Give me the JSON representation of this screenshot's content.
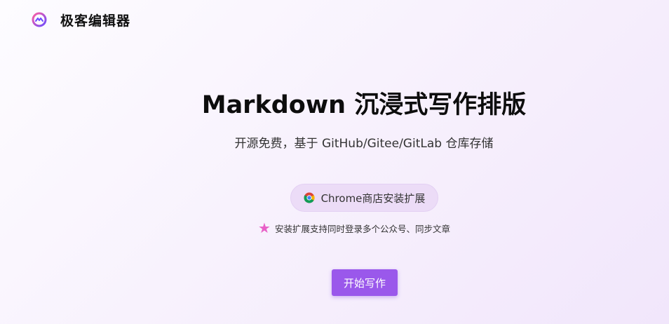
{
  "header": {
    "logo_icon": "editor-logo-icon",
    "app_name": "极客编辑器"
  },
  "hero": {
    "title": "Markdown 沉浸式写作排版",
    "subtitle": "开源免费，基于 GitHub/Gitee/GitLab 仓库存储"
  },
  "chrome_install": {
    "icon": "chrome-icon",
    "label": "Chrome商店安装扩展"
  },
  "hint": {
    "icon": "star-icon",
    "text": "安装扩展支持同时登录多个公众号、同步文章"
  },
  "start_button": {
    "label": "开始写作"
  },
  "colors": {
    "accent": "#9a58eb",
    "star": "#e85fc7",
    "pill_bg": "#ecdcf7"
  }
}
